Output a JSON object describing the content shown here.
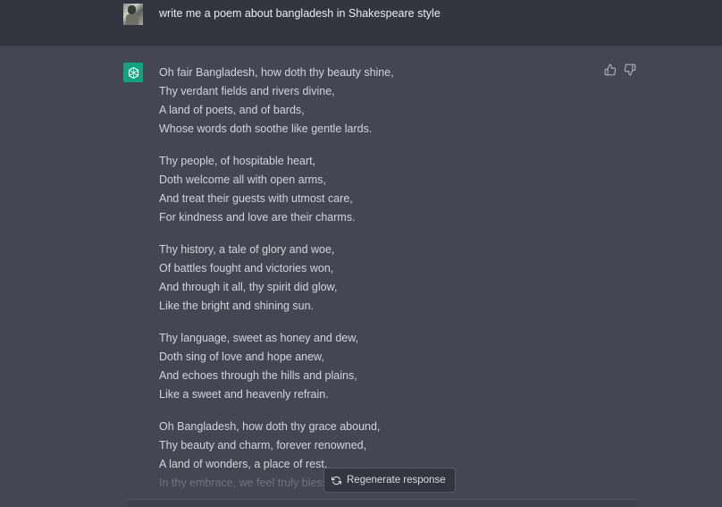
{
  "user_message": {
    "text": "write me a poem about bangladesh in Shakespeare style"
  },
  "assistant_message": {
    "stanzas": [
      [
        "Oh fair Bangladesh, how doth thy beauty shine,",
        "Thy verdant fields and rivers divine,",
        "A land of poets, and of bards,",
        "Whose words doth soothe like gentle lards."
      ],
      [
        "Thy people, of hospitable heart,",
        "Doth welcome all with open arms,",
        "And treat their guests with utmost care,",
        "For kindness and love are their charms."
      ],
      [
        "Thy history, a tale of glory and woe,",
        "Of battles fought and victories won,",
        "And through it all, thy spirit did glow,",
        "Like the bright and shining sun."
      ],
      [
        "Thy language, sweet as honey and dew,",
        "Doth sing of love and hope anew,",
        "And echoes through the hills and plains,",
        "Like a sweet and heavenly refrain."
      ],
      [
        "Oh Bangladesh, how doth thy grace abound,",
        "Thy beauty and charm, forever renowned,",
        "A land of wonders, a place of rest,",
        "In thy embrace, we feel truly blessed."
      ]
    ]
  },
  "actions": {
    "regenerate_label": "Regenerate response"
  },
  "icons": {
    "assistant_logo": "openai-logo-icon",
    "thumbs_up": "thumbs-up-icon",
    "thumbs_down": "thumbs-down-icon",
    "regenerate": "refresh-icon"
  },
  "colors": {
    "user_bg": "#343541",
    "assistant_bg": "#444654",
    "brand": "#10a37f",
    "text": "#d1d5db"
  }
}
